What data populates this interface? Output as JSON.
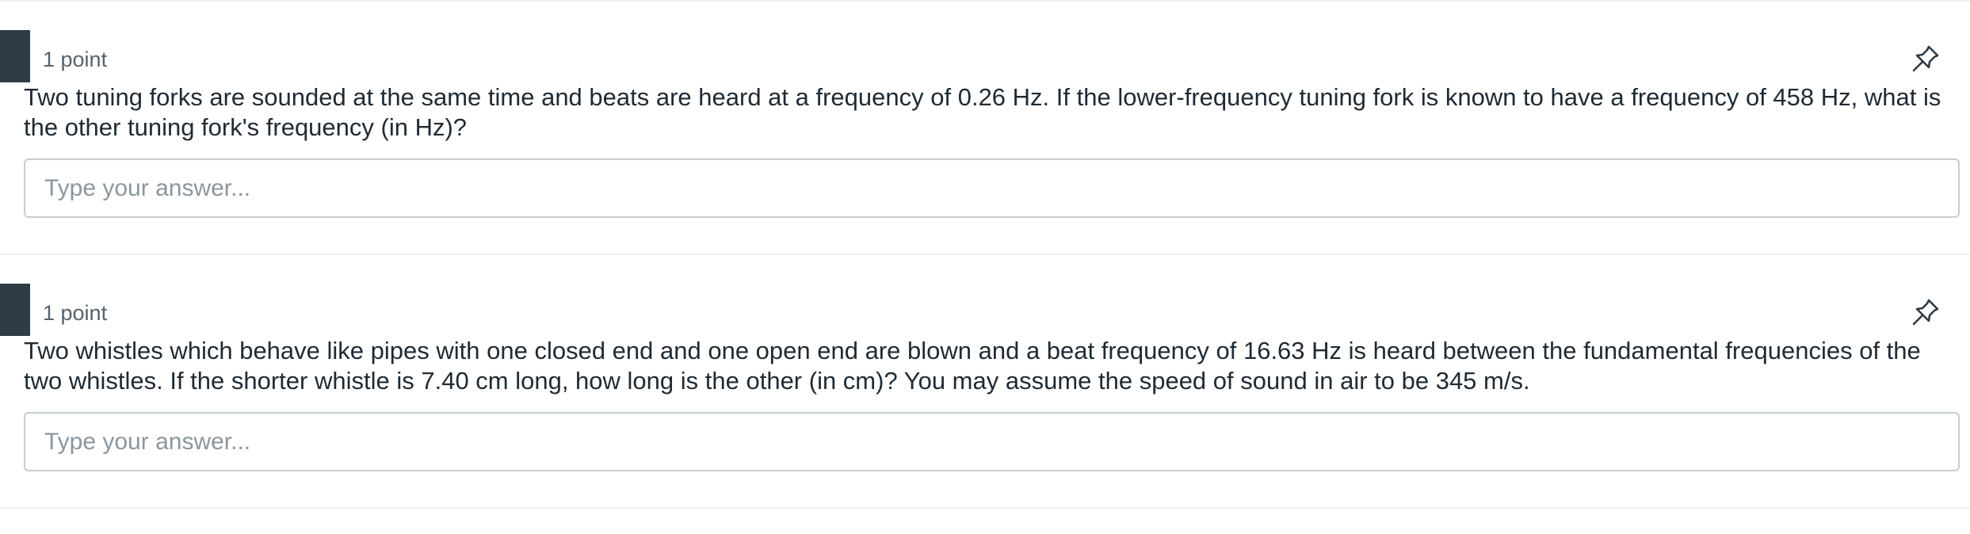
{
  "questions": [
    {
      "points": "1 point",
      "pin_icon": "pin-icon",
      "text": "Two tuning forks are sounded at the same time and beats are heard at a frequency of 0.26 Hz.  If the lower-frequency tuning fork is known to have a frequency of 458 Hz, what is the other tuning fork's frequency (in Hz)?",
      "answer_value": "",
      "answer_placeholder": "Type your answer..."
    },
    {
      "points": "1 point",
      "pin_icon": "pin-icon",
      "text": "Two whistles which behave like pipes with one closed end and one open end are blown and a beat frequency of 16.63 Hz is heard between the fundamental frequencies of the two whistles.  If the shorter whistle is 7.40 cm long, how long is the other (in cm)?  You may assume the speed of sound in air to be 345 m/s.",
      "answer_value": "",
      "answer_placeholder": "Type your answer..."
    }
  ],
  "colors": {
    "marker": "#303c45",
    "text": "#1f2a33",
    "muted": "#56626b",
    "border": "#c7cdd1"
  }
}
